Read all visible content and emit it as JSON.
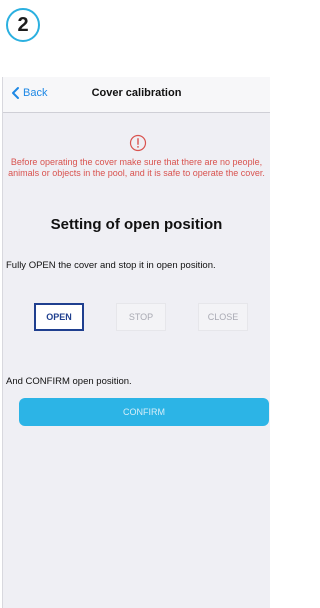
{
  "step": {
    "number": "2"
  },
  "navbar": {
    "back_label": "Back",
    "title": "Cover calibration"
  },
  "warning": {
    "icon": "exclamation-circle-icon",
    "text": "Before operating the cover make sure that there are no people, animals or objects in the pool, and it is safe to operate the cover."
  },
  "section": {
    "title": "Setting of open position",
    "instruction": "Fully OPEN the cover and stop it in open position."
  },
  "controls": {
    "open_label": "OPEN",
    "stop_label": "STOP",
    "close_label": "CLOSE"
  },
  "confirm": {
    "text": "And CONFIRM open position.",
    "button_label": "CONFIRM"
  },
  "colors": {
    "accent": "#2cb4e6",
    "back_link": "#1e88e5",
    "warning": "#d9534f",
    "selected_button_border": "#1f3f8f"
  }
}
